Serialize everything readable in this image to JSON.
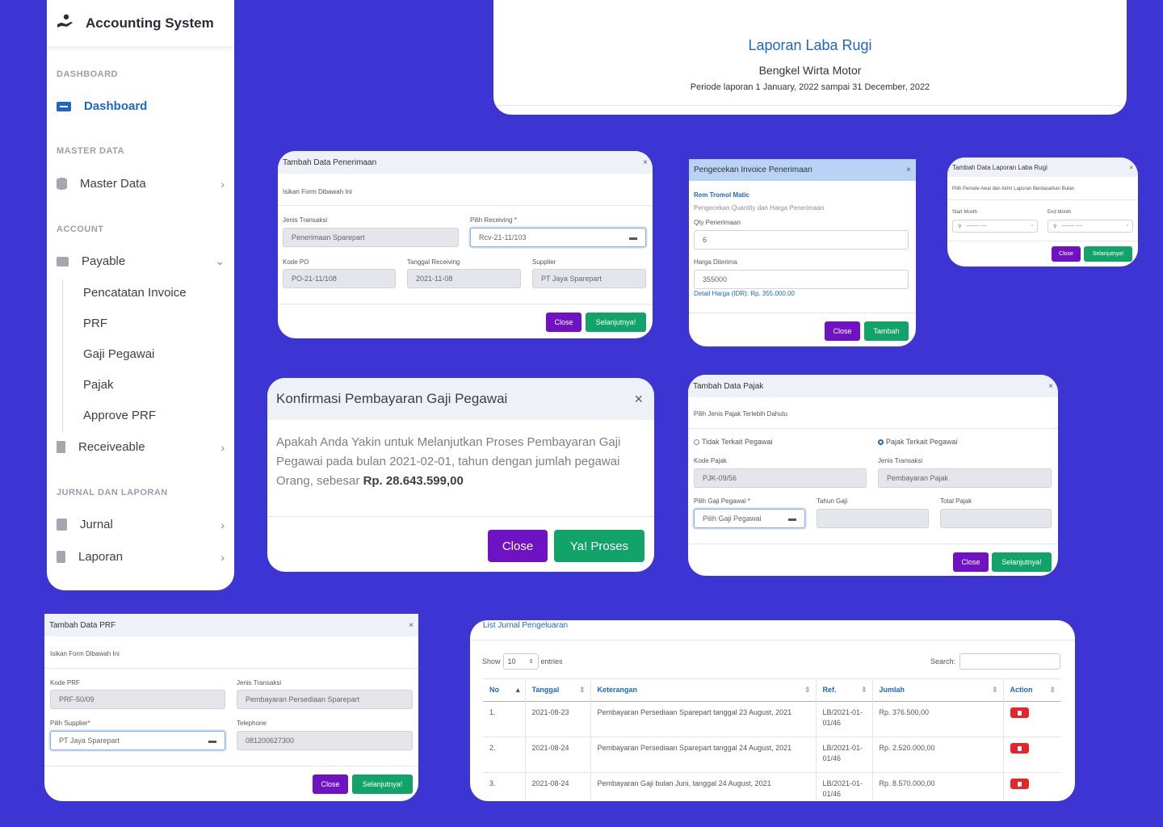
{
  "app": {
    "title": "Accounting System"
  },
  "sidebar": {
    "sections": {
      "dashboard": "DASHBOARD",
      "master": "MASTER DATA",
      "account": "ACCOUNT",
      "jurnal": "JURNAL DAN LAPORAN"
    },
    "items": {
      "dashboard": "Dashboard",
      "master_data": "Master Data",
      "payable": "Payable",
      "receiveable": "Receiveable",
      "jurnal": "Jurnal",
      "laporan": "Laporan"
    },
    "payable_sub": [
      "Pencatatan Invoice",
      "PRF",
      "Gaji Pegawai",
      "Pajak",
      "Approve PRF"
    ]
  },
  "laporan": {
    "title": "Laporan Laba Rugi",
    "company": "Bengkel Wirta Motor",
    "period": "Periode laporan 1 January, 2022 sampai 31 December, 2022"
  },
  "penerimaan": {
    "title": "Tambah Data Penerimaan",
    "close_x": "×",
    "subtitle": "Isikan Form Dibawah Ini",
    "jenis_label": "Jenis Transaksi",
    "jenis_value": "Penerimaan Sparepart",
    "receiving_label": "Pilih Receiving",
    "receiving_value": "Rcv-21-11/103",
    "kode_po_label": "Kode PO",
    "kode_po_value": "PO-21-11/108",
    "tanggal_label": "Tanggal Receiving",
    "tanggal_value": "2021-11-08",
    "supplier_label": "Supplier",
    "supplier_value": "PT Jaya Sparepart",
    "close": "Close",
    "next": "Selanjutnya!"
  },
  "invoice": {
    "title": "Pengecekan Invoice Penerimaan",
    "close_x": "×",
    "item": "Rem Tromol Matic",
    "desc": "Pengecekan Quantity dan Harga Penerimaan",
    "qty_label": "Qty Penerimaan",
    "qty_value": "6",
    "harga_label": "Harga Diterima",
    "harga_value": "355000",
    "detail": "Detail Harga (IDR): Rp. 355.000,00",
    "close": "Close",
    "add": "Tambah"
  },
  "labarugi": {
    "title": "Tambah Data Laporan Laba Rugi",
    "close_x": "×",
    "desc": "Pilih Periode Awal dan Akhir Laporan Berdasarkan Bulan",
    "start_label": "Start Month",
    "end_label": "End Month",
    "placeholder": "-------- ----",
    "close": "Close",
    "next": "Selanjutnya!"
  },
  "konfirmasi": {
    "title": "Konfirmasi Pembayaran Gaji Pegawai",
    "close_x": "×",
    "body": "Apakah Anda Yakin untuk Melanjutkan Proses Pembayaran Gaji Pegawai pada bulan 2021-02-01, tahun dengan jumlah pegawai Orang, sebesar ",
    "amount": "Rp. 28.643.599,00",
    "close": "Close",
    "proceed": "Ya! Proses"
  },
  "pajak": {
    "title": "Tambah Data Pajak",
    "close_x": "×",
    "desc": "Pilih Jenis Pajak Terlebih Dahulu",
    "radio1": "Tidak Terkait Pegawai",
    "radio2": "Pajak Terkait Pegawai",
    "kode_label": "Kode Pajak",
    "kode_value": "PJK-09/56",
    "jenis_label": "Jenis Transaksi",
    "jenis_value": "Pembayaran Pajak",
    "gaji_label": "Pilih Gaji Pegawai",
    "gaji_value": "Pilih Gaji Pegawai",
    "tahun_label": "Tahun Gaji",
    "total_label": "Total Pajak",
    "close": "Close",
    "next": "Selanjutnya!"
  },
  "prf": {
    "title": "Tambah Data PRF",
    "close_x": "×",
    "subtitle": "Isikan Form Dibawah Ini",
    "kode_label": "Kode PRF",
    "kode_value": "PRF-50/09",
    "jenis_label": "Jenis Transaksi",
    "jenis_value": "Pembayaran Persediaan Sparepart",
    "supplier_label": "Pilih Supplier",
    "supplier_value": "PT Jaya Sparepart",
    "phone_label": "Telephone",
    "phone_value": "081200627300",
    "close": "Close",
    "next": "Selanjutnya!"
  },
  "jurnal": {
    "title": "List Jurnal Pengeluaran",
    "show": "Show",
    "entries_value": "10",
    "entries": "entries",
    "search": "Search:",
    "headers": [
      "No",
      "Tanggal",
      "Keterangan",
      "Ref.",
      "Jumlah",
      "Action"
    ],
    "rows": [
      {
        "no": "1.",
        "tanggal": "2021-08-23",
        "ket": "Pembayaran Persediaan Sparepart tanggal 23 August, 2021",
        "ref": "LB/2021-01-01/46",
        "jumlah": "Rp. 376.500,00"
      },
      {
        "no": "2.",
        "tanggal": "2021-08-24",
        "ket": "Pembayaran Persediaan Sparepart tanggal 24 August, 2021",
        "ref": "LB/2021-01-01/46",
        "jumlah": "Rp. 2.520.000,00"
      },
      {
        "no": "3.",
        "tanggal": "2021-08-24",
        "ket": "Pembayaran Gaji bulan Juni, tanggal 24 August, 2021",
        "ref": "LB/2021-01-01/46",
        "jumlah": "Rp. 8.570.000,00"
      }
    ]
  },
  "colors": {
    "background": "#3c35d4",
    "accent": "#1f66c6",
    "purple": "#6f12c4",
    "green": "#12a36a",
    "danger": "#e8242b"
  }
}
